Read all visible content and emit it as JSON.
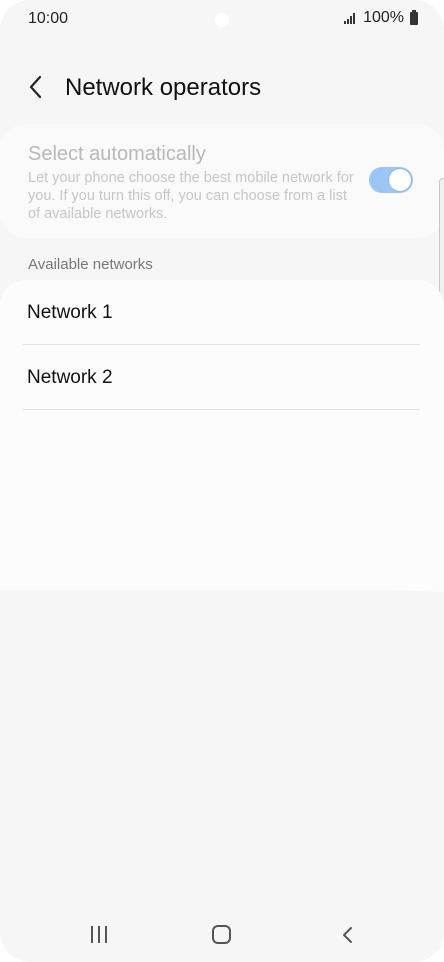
{
  "status": {
    "time": "10:00",
    "battery": "100%"
  },
  "header": {
    "title": "Network operators"
  },
  "auto_select": {
    "title": "Select automatically",
    "description": "Let your phone choose the best mobile network for you. If you turn this off, you can choose from a list of available networks.",
    "enabled": true
  },
  "available": {
    "section_label": "Available networks",
    "networks": [
      {
        "label": "Network 1"
      },
      {
        "label": "Network 2"
      }
    ]
  },
  "colors": {
    "toggle_track": "#9cc6f3",
    "background": "#f6f6f6"
  },
  "icons": {
    "back": "chevron-left-icon",
    "recent": "recent-apps-icon",
    "home": "home-icon",
    "nav_back": "nav-back-icon"
  }
}
